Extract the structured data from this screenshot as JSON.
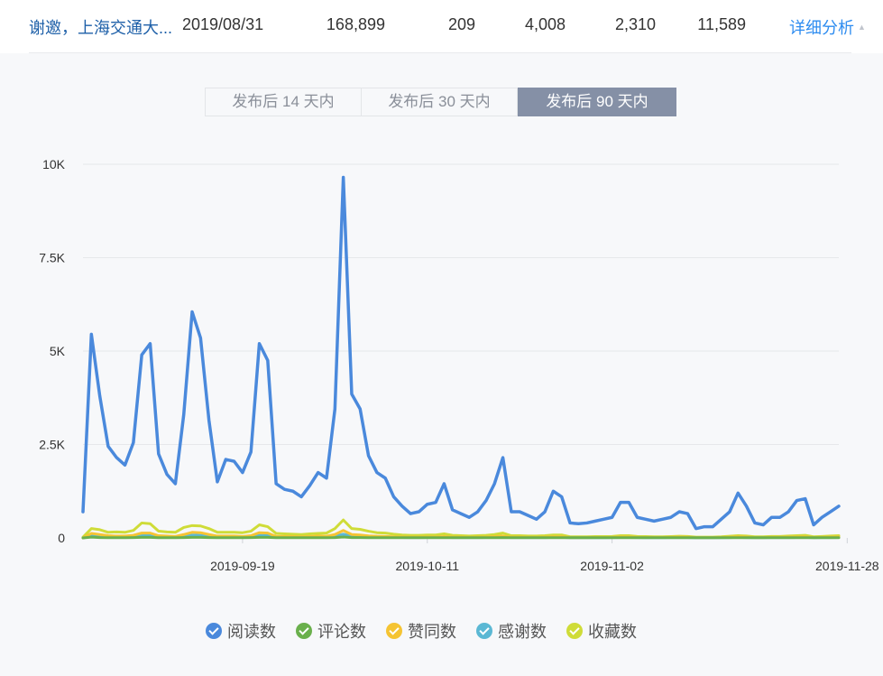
{
  "answer_row": {
    "title": "谢邀，上海交通大...",
    "date": "2019/08/31",
    "views": "168,899",
    "comments": "209",
    "upvotes": "4,008",
    "thanks": "2,310",
    "favorites": "11,589",
    "detail_link": "详细分析",
    "detail_caret": "▲"
  },
  "tabs": [
    {
      "label": "发布后 14 天内",
      "active": false
    },
    {
      "label": "发布后 30 天内",
      "active": false
    },
    {
      "label": "发布后 90 天内",
      "active": true
    }
  ],
  "legend": [
    {
      "label": "阅读数",
      "color": "#4a89dc"
    },
    {
      "label": "评论数",
      "color": "#6ab04c"
    },
    {
      "label": "赞同数",
      "color": "#f5c433"
    },
    {
      "label": "感谢数",
      "color": "#5bb8d4"
    },
    {
      "label": "收藏数",
      "color": "#cfdc38"
    }
  ],
  "chart_data": {
    "type": "line",
    "x_tick_labels": [
      "2019-09-19",
      "2019-10-11",
      "2019-11-02",
      "2019-11-28"
    ],
    "x_tick_index": [
      19,
      41,
      63,
      91
    ],
    "y_tick_labels": [
      "0",
      "2.5K",
      "5K",
      "7.5K",
      "10K"
    ],
    "y_tick_values": [
      0,
      2500,
      5000,
      7500,
      10000
    ],
    "ylim": [
      0,
      10000
    ],
    "grid": true,
    "legend_position": "bottom",
    "series": [
      {
        "name": "阅读数",
        "color": "#4a89dc",
        "values": [
          700,
          5450,
          3800,
          2450,
          2150,
          1950,
          2550,
          4900,
          5200,
          2250,
          1700,
          1450,
          3300,
          6050,
          5350,
          3150,
          1500,
          2100,
          2050,
          1750,
          2300,
          5200,
          4750,
          1450,
          1300,
          1250,
          1100,
          1400,
          1750,
          1600,
          3450,
          9650,
          3850,
          3450,
          2200,
          1750,
          1600,
          1100,
          850,
          650,
          700,
          900,
          950,
          1450,
          750,
          650,
          550,
          700,
          1000,
          1450,
          2150,
          700,
          700,
          600,
          500,
          700,
          1250,
          1100,
          400,
          380,
          400,
          450,
          500,
          550,
          950,
          950,
          550,
          500,
          450,
          500,
          550,
          700,
          650,
          250,
          300,
          300,
          500,
          700,
          1200,
          850,
          400,
          350,
          550,
          550,
          700,
          1000,
          1050,
          350,
          550,
          700,
          850
        ]
      },
      {
        "name": "评论数",
        "color": "#6ab04c",
        "values": [
          0,
          20,
          10,
          5,
          5,
          5,
          10,
          15,
          15,
          5,
          5,
          5,
          10,
          15,
          15,
          10,
          5,
          5,
          5,
          5,
          10,
          15,
          15,
          5,
          5,
          5,
          5,
          5,
          5,
          5,
          10,
          25,
          10,
          10,
          5,
          5,
          5,
          5,
          5,
          5,
          5,
          5,
          5,
          5,
          5,
          5,
          5,
          5,
          5,
          5,
          10,
          5,
          5,
          5,
          5,
          5,
          5,
          5,
          5,
          5,
          5,
          5,
          5,
          5,
          5,
          5,
          5,
          5,
          5,
          5,
          5,
          5,
          5,
          5,
          5,
          5,
          5,
          5,
          5,
          5,
          5,
          5,
          5,
          5,
          5,
          5,
          5,
          5,
          5,
          5,
          5
        ]
      },
      {
        "name": "赞同数",
        "color": "#f5c433",
        "values": [
          0,
          120,
          90,
          60,
          50,
          50,
          70,
          130,
          130,
          60,
          50,
          40,
          90,
          150,
          140,
          90,
          50,
          50,
          50,
          40,
          60,
          140,
          130,
          40,
          40,
          35,
          30,
          40,
          50,
          45,
          90,
          200,
          90,
          80,
          55,
          45,
          40,
          30,
          25,
          20,
          20,
          25,
          25,
          35,
          20,
          20,
          15,
          20,
          25,
          35,
          50,
          20,
          20,
          15,
          15,
          20,
          30,
          30,
          10,
          10,
          10,
          12,
          12,
          15,
          25,
          25,
          15,
          12,
          12,
          12,
          15,
          20,
          18,
          8,
          8,
          8,
          12,
          18,
          30,
          20,
          10,
          10,
          15,
          15,
          20,
          25,
          28,
          10,
          15,
          20,
          25
        ]
      },
      {
        "name": "感谢数",
        "color": "#5bb8d4",
        "values": [
          0,
          60,
          45,
          30,
          25,
          25,
          35,
          65,
          65,
          30,
          25,
          20,
          45,
          75,
          70,
          45,
          25,
          25,
          25,
          20,
          30,
          70,
          65,
          20,
          20,
          18,
          15,
          20,
          25,
          22,
          45,
          100,
          45,
          40,
          28,
          22,
          20,
          15,
          12,
          10,
          10,
          12,
          12,
          18,
          10,
          10,
          8,
          10,
          12,
          18,
          25,
          10,
          10,
          8,
          8,
          10,
          15,
          15,
          5,
          5,
          5,
          6,
          6,
          8,
          12,
          12,
          8,
          6,
          6,
          6,
          8,
          10,
          9,
          4,
          4,
          4,
          6,
          9,
          15,
          10,
          5,
          5,
          8,
          8,
          10,
          12,
          14,
          5,
          8,
          10,
          12
        ]
      },
      {
        "name": "收藏数",
        "color": "#cfdc38",
        "values": [
          20,
          250,
          220,
          150,
          160,
          150,
          200,
          400,
          380,
          180,
          160,
          150,
          280,
          330,
          320,
          250,
          150,
          150,
          150,
          140,
          180,
          350,
          300,
          120,
          110,
          100,
          90,
          110,
          120,
          130,
          250,
          480,
          250,
          230,
          180,
          140,
          130,
          100,
          80,
          70,
          70,
          80,
          80,
          110,
          70,
          60,
          50,
          60,
          70,
          90,
          130,
          60,
          60,
          50,
          50,
          60,
          80,
          80,
          30,
          30,
          30,
          35,
          35,
          40,
          60,
          60,
          40,
          35,
          30,
          30,
          35,
          45,
          40,
          20,
          20,
          20,
          30,
          45,
          60,
          50,
          30,
          30,
          40,
          40,
          50,
          60,
          70,
          30,
          40,
          50,
          60
        ]
      }
    ]
  }
}
